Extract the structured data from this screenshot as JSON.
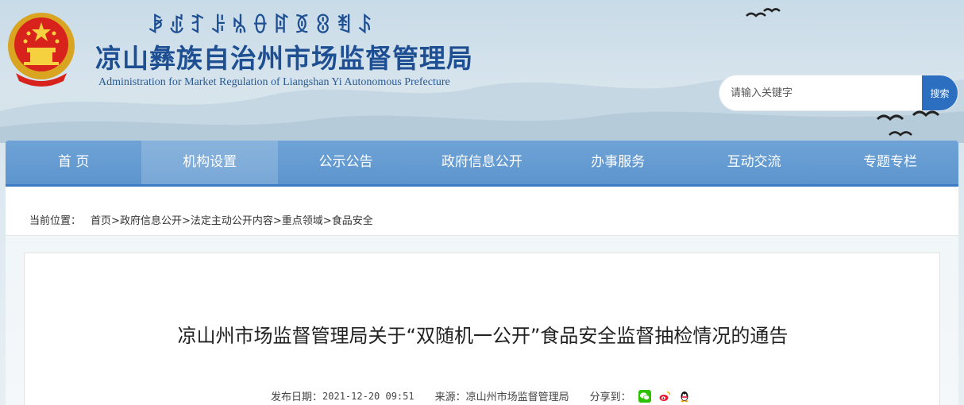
{
  "header": {
    "yi_script": "ꆃꍑꆈꌠꁱꂷꍏꅉꐪꄮꌺ",
    "title": "凉山彝族自治州市场监督管理局",
    "subtitle": "Administration for Market Regulation of Liangshan Yi Autonomous Prefecture"
  },
  "search": {
    "placeholder": "请输入关键字",
    "button_label": "搜索"
  },
  "nav": {
    "items": [
      {
        "label": "首 页"
      },
      {
        "label": "机构设置"
      },
      {
        "label": "公示公告"
      },
      {
        "label": "政府信息公开"
      },
      {
        "label": "办事服务"
      },
      {
        "label": "互动交流"
      },
      {
        "label": "专题专栏"
      }
    ],
    "active_index": 1
  },
  "breadcrumb": {
    "label": "当前位置：",
    "items": [
      "首页",
      "政府信息公开",
      "法定主动公开内容",
      "重点领域",
      "食品安全"
    ],
    "separator": ">"
  },
  "article": {
    "title": "凉山州市场监督管理局关于“双随机一公开”食品安全监督抽检情况的通告",
    "date_label": "发布日期：",
    "date": "2021-12-20 09:51",
    "source_label": "来源：",
    "source": "凉山州市场监督管理局",
    "share_label": "分享到："
  },
  "colors": {
    "nav_bg": "#5b94cd",
    "title_blue": "#1f4f93",
    "search_button": "#2c6fc0",
    "wechat": "#2dc100",
    "weibo": "#e6162d",
    "qq": "#1e88e5"
  },
  "icons": {
    "share": [
      "wechat-icon",
      "weibo-icon",
      "qq-icon"
    ]
  }
}
